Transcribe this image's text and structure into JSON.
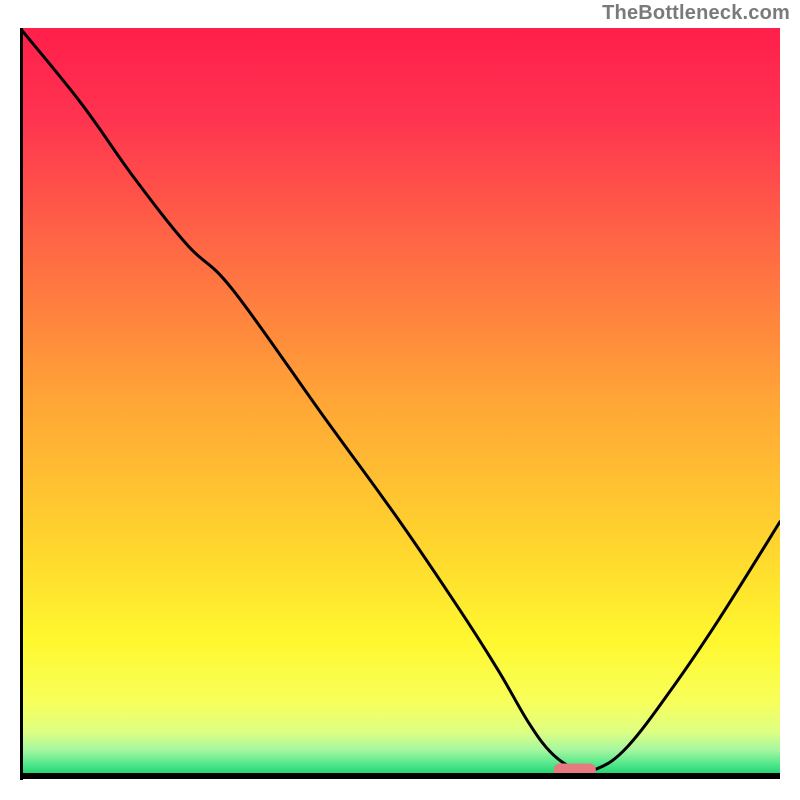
{
  "watermark": "TheBottleneck.com",
  "chart_data": {
    "type": "line",
    "title": "",
    "xlabel": "",
    "ylabel": "",
    "x_range": [
      0,
      100
    ],
    "y_range": [
      0,
      100
    ],
    "curve": {
      "x": [
        0,
        8,
        15,
        22,
        28,
        40,
        50,
        58,
        63,
        67,
        70,
        73,
        76,
        80,
        86,
        92,
        100
      ],
      "y": [
        100,
        90,
        80,
        71,
        65,
        48,
        34,
        22,
        14,
        7,
        3,
        1,
        1,
        4,
        12,
        21,
        34
      ]
    },
    "marker": {
      "x": 73,
      "y": 1,
      "color": "#e67a7f"
    },
    "gradient_stops": [
      {
        "pos": 0.0,
        "color": "#ff1f4b"
      },
      {
        "pos": 0.12,
        "color": "#ff3350"
      },
      {
        "pos": 0.3,
        "color": "#ff6a44"
      },
      {
        "pos": 0.5,
        "color": "#ffa636"
      },
      {
        "pos": 0.68,
        "color": "#ffd22e"
      },
      {
        "pos": 0.82,
        "color": "#fff82f"
      },
      {
        "pos": 0.9,
        "color": "#f8ff5a"
      },
      {
        "pos": 0.94,
        "color": "#dfff82"
      },
      {
        "pos": 0.965,
        "color": "#a6f7a0"
      },
      {
        "pos": 0.985,
        "color": "#4fe68a"
      },
      {
        "pos": 1.0,
        "color": "#17cf6b"
      }
    ],
    "axis_color": "#000000"
  }
}
